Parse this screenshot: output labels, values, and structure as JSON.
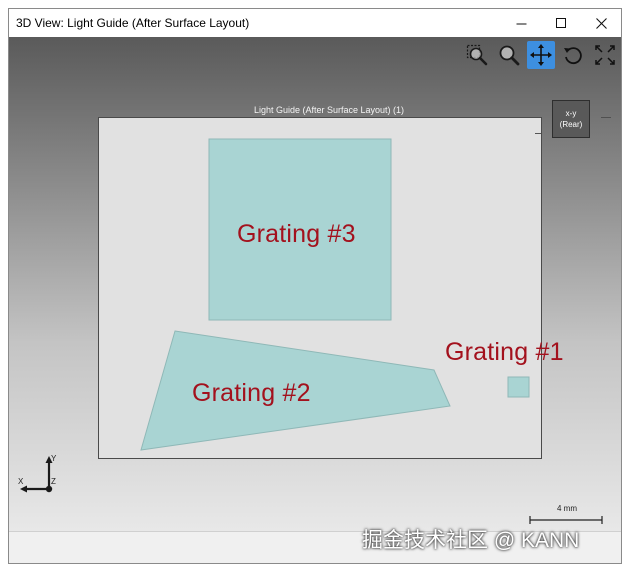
{
  "window": {
    "title": "3D View: Light Guide (After Surface Layout)",
    "minimize_glyph": "—",
    "maximize_glyph": "☐",
    "close_glyph": "✕"
  },
  "toolbar": {
    "tools": [
      {
        "name": "zoom-window-icon",
        "active": false
      },
      {
        "name": "zoom-icon",
        "active": false
      },
      {
        "name": "pan-icon",
        "active": true
      },
      {
        "name": "rotate-icon",
        "active": false
      },
      {
        "name": "fit-view-icon",
        "active": false
      }
    ],
    "active_color": "#3d8fe0"
  },
  "viewport": {
    "plot_title": "Light Guide (After Surface Layout) (1)",
    "view_cube": {
      "line1": "x-y",
      "line2": "(Rear)"
    },
    "gratings": [
      {
        "label": "Grating #3"
      },
      {
        "label": "Grating #2"
      },
      {
        "label": "Grating #1"
      }
    ],
    "grating_fill": "#a9d4d3",
    "label_color": "#a3111d",
    "axes": {
      "y": "Y",
      "x": "X",
      "z": "Z"
    },
    "scale_bar": {
      "label": "4 mm"
    }
  },
  "watermark": "掘金技术社区 @ KANN"
}
